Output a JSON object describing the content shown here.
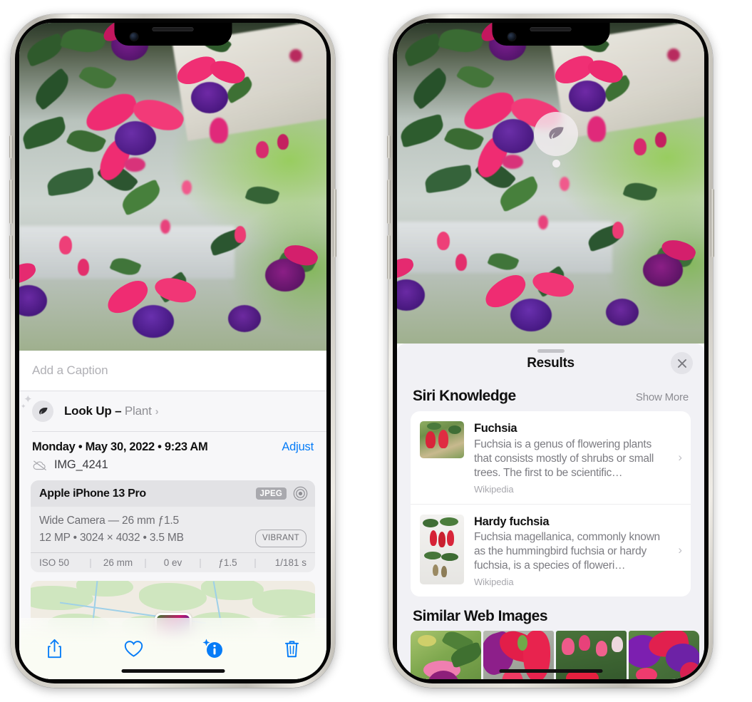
{
  "left_phone": {
    "caption": {
      "placeholder": "Add a Caption",
      "value": ""
    },
    "lookup": {
      "icon": "leaf-icon",
      "sparkle_icon": "sparkles-icon",
      "label": "Look Up – ",
      "subject": "Plant",
      "chevron": "›"
    },
    "metadata": {
      "date": "Monday • May 30, 2022 • 9:23 AM",
      "adjust_label": "Adjust",
      "cloud_icon": "cloud-slash-icon",
      "filename": "IMG_4241"
    },
    "exif": {
      "device": "Apple iPhone 13 Pro",
      "format_badge": "JPEG",
      "hdr_icon": "target-circles-icon",
      "lens": "Wide Camera — 26 mm ƒ1.5",
      "size": "12 MP • 3024 × 4032 • 3.5 MB",
      "style_badge": "VIBRANT",
      "stats": [
        "ISO 50",
        "26 mm",
        "0 ev",
        "ƒ1.5",
        "1/181 s"
      ],
      "divider": "|"
    },
    "toolbar": [
      {
        "name": "share-icon",
        "label": "Share"
      },
      {
        "name": "heart-icon",
        "label": "Favorite"
      },
      {
        "name": "info-sparkle-icon",
        "label": "Info"
      },
      {
        "name": "trash-icon",
        "label": "Delete"
      }
    ],
    "accent_color": "#067cf7"
  },
  "right_phone": {
    "visual_lookup_badge": {
      "icon": "leaf-icon",
      "label": "Plant detected"
    },
    "sheet": {
      "title": "Results",
      "close_icon": "close-icon",
      "grabber": "drag-handle"
    },
    "siri_knowledge": {
      "heading": "Siri Knowledge",
      "show_more": "Show More",
      "items": [
        {
          "title": "Fuchsia",
          "description": "Fuchsia is a genus of flowering plants that consists mostly of shrubs or small trees. The first to be scientific…",
          "source": "Wikipedia",
          "chevron": "›"
        },
        {
          "title": "Hardy fuchsia",
          "description": "Fuchsia magellanica, commonly known as the hummingbird fuchsia or hardy fuchsia, is a species of floweri…",
          "source": "Wikipedia",
          "chevron": "›"
        }
      ]
    },
    "similar_web_images": {
      "heading": "Similar Web Images",
      "count": 4
    }
  }
}
